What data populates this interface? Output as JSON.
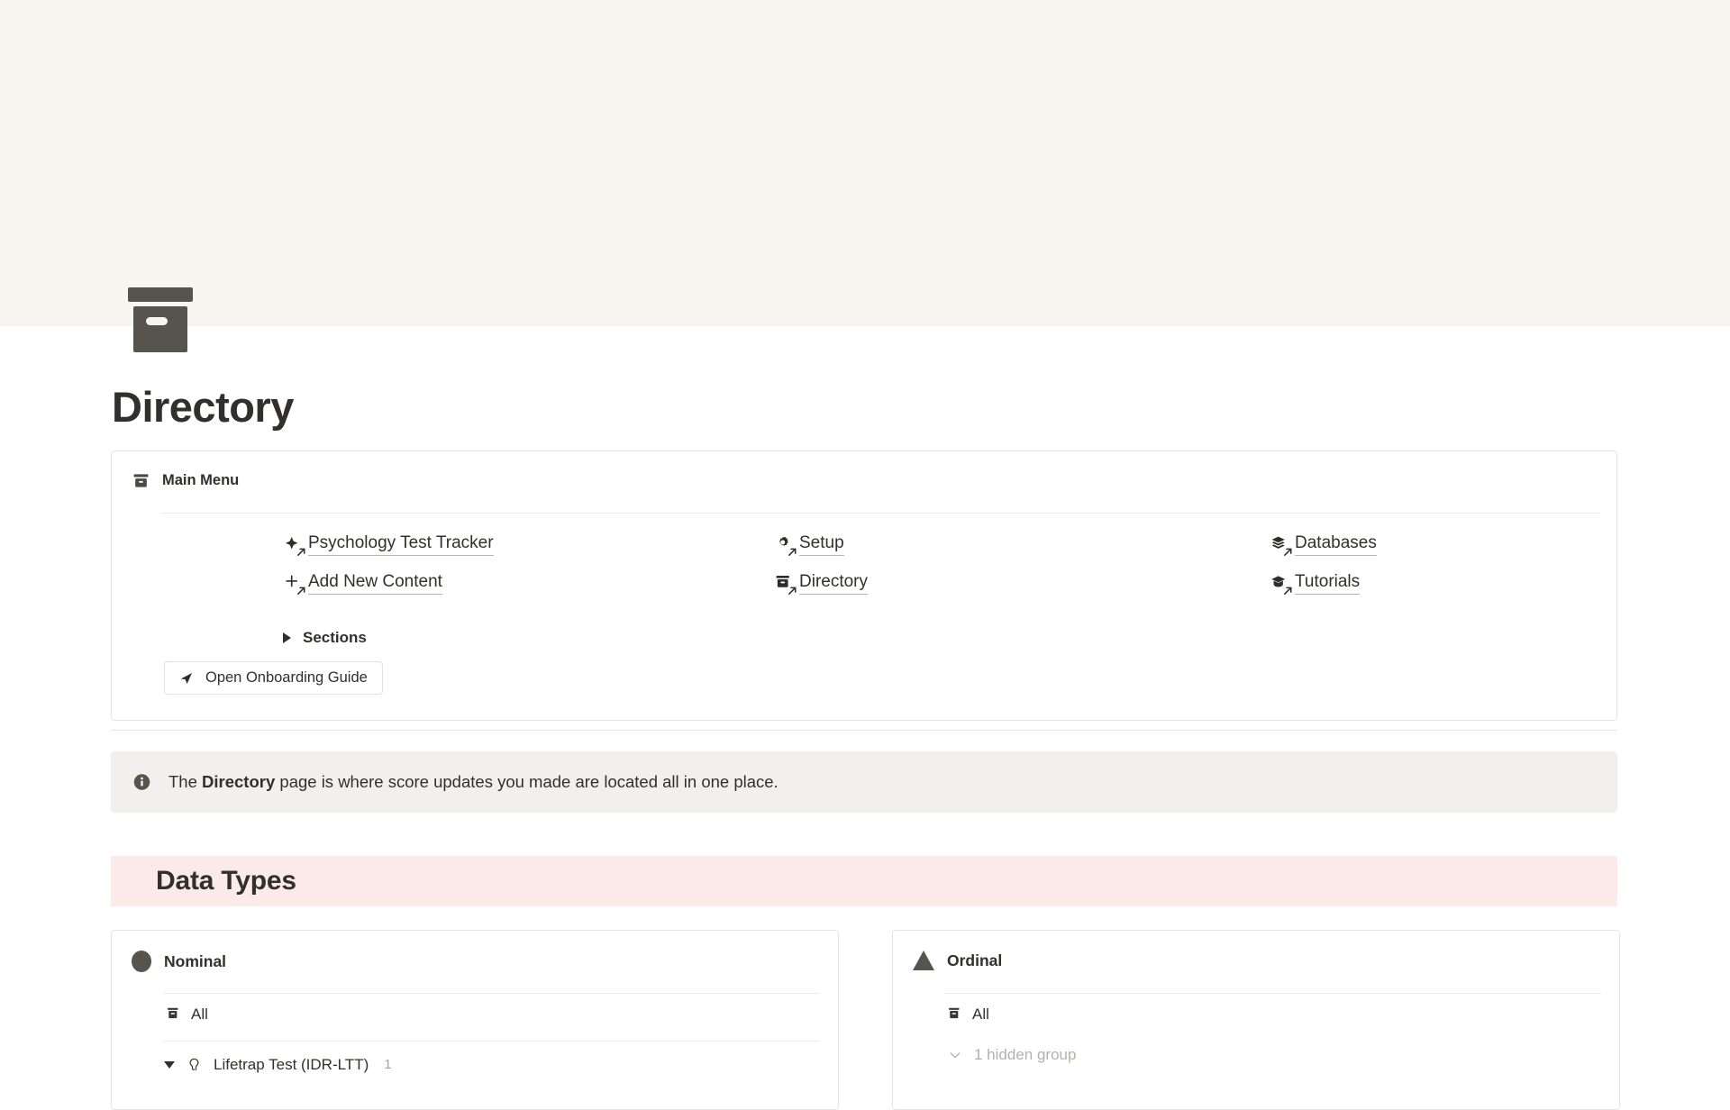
{
  "page": {
    "icon": "archive-box-icon",
    "title": "Directory",
    "cover_color": "#f6f5f0"
  },
  "main_menu": {
    "header_label": "Main Menu",
    "header_icon": "archive-box-icon",
    "links": [
      {
        "label": "Psychology Test Tracker",
        "icon": "sparkle-icon",
        "column": 1,
        "row": 1
      },
      {
        "label": "Add New Content",
        "icon": "plus-icon",
        "column": 1,
        "row": 2
      },
      {
        "label": "Setup",
        "icon": "gear-icon",
        "column": 2,
        "row": 1
      },
      {
        "label": "Directory",
        "icon": "archive-box-icon",
        "column": 2,
        "row": 2
      },
      {
        "label": "Databases",
        "icon": "layers-icon",
        "column": 3,
        "row": 1
      },
      {
        "label": "Tutorials",
        "icon": "graduation-cap-icon",
        "column": 3,
        "row": 2
      }
    ],
    "sections_toggle": {
      "label": "Sections",
      "state": "collapsed",
      "icon": "triangle-right-icon"
    },
    "onboarding_button": {
      "label": "Open Onboarding Guide",
      "icon": "send-icon"
    }
  },
  "callout": {
    "icon": "info-icon",
    "text_before": "The ",
    "text_bold": "Directory",
    "text_after": " page is where score updates you made are located all in one place.",
    "background": "#f1f0ee"
  },
  "section_heading": {
    "label": "Data Types",
    "background": "#fbeae8"
  },
  "databases": [
    {
      "title": "Nominal",
      "icon": "circle-icon",
      "tab_label": "All",
      "tab_icon": "archive-box-icon",
      "group": {
        "label": "Lifetrap Test (IDR-LTT)",
        "count": "1",
        "icon": "psychology-head-icon",
        "state": "expanded"
      }
    },
    {
      "title": "Ordinal",
      "icon": "triangle-icon",
      "tab_label": "All",
      "tab_icon": "archive-box-icon",
      "hidden_group": {
        "label": "1 hidden group",
        "icon": "chevron-down-icon"
      }
    }
  ]
}
